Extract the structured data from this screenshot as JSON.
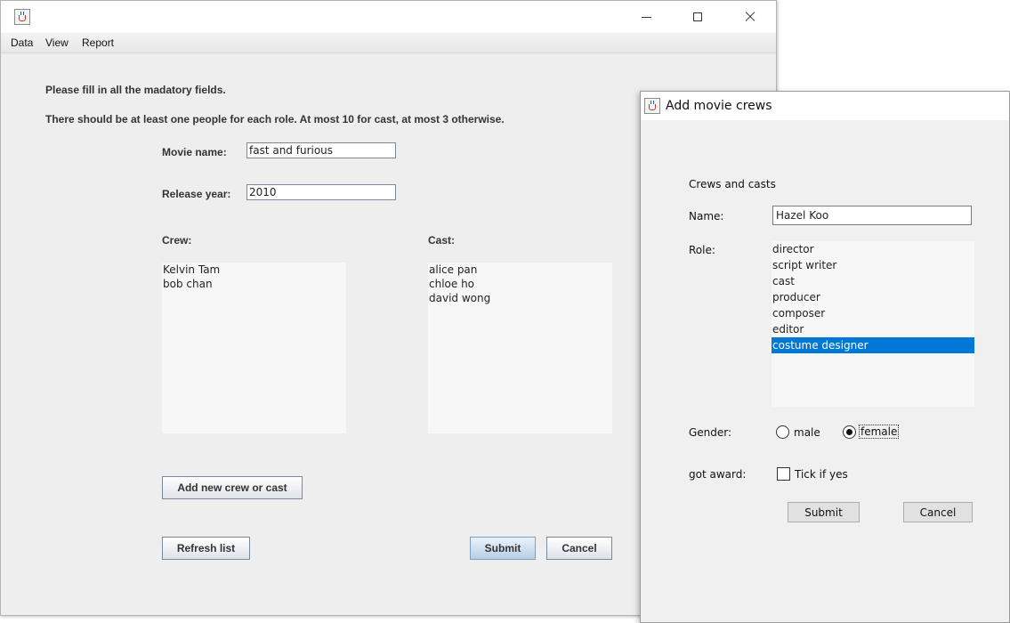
{
  "main_window": {
    "menu": [
      "Data",
      "View",
      "Report"
    ],
    "instructions": [
      "Please fill in all the madatory fields.",
      "There should be at least one people for each role. At most 10 for cast, at most 3 otherwise."
    ],
    "movie_name_label": "Movie name:",
    "movie_name_value": "fast and furious",
    "release_year_label": "Release year:",
    "release_year_value": "2010",
    "crew_label": "Crew:",
    "crew_list": [
      "Kelvin Tam",
      "bob chan"
    ],
    "cast_label": "Cast:",
    "cast_list": [
      "alice pan",
      "chloe ho",
      "david wong"
    ],
    "add_button": "Add new crew or cast",
    "refresh_button": "Refresh list",
    "submit_button": "Submit",
    "cancel_button": "Cancel"
  },
  "dialog": {
    "title": "Add movie crews",
    "section_label": "Crews and casts",
    "name_label": "Name:",
    "name_value": "Hazel Koo",
    "role_label": "Role:",
    "roles": [
      "director",
      "script writer",
      "cast",
      "producer",
      "composer",
      "editor",
      "costume designer"
    ],
    "selected_role": "costume designer",
    "gender_label": "Gender:",
    "gender_options": [
      "male",
      "female"
    ],
    "gender_selected": "female",
    "award_label": "got award:",
    "award_checkbox_label": "Tick if yes",
    "award_checked": false,
    "submit_button": "Submit",
    "cancel_button": "Cancel"
  },
  "colors": {
    "selection": "#0078d7",
    "window_bg": "#eeeeee"
  }
}
